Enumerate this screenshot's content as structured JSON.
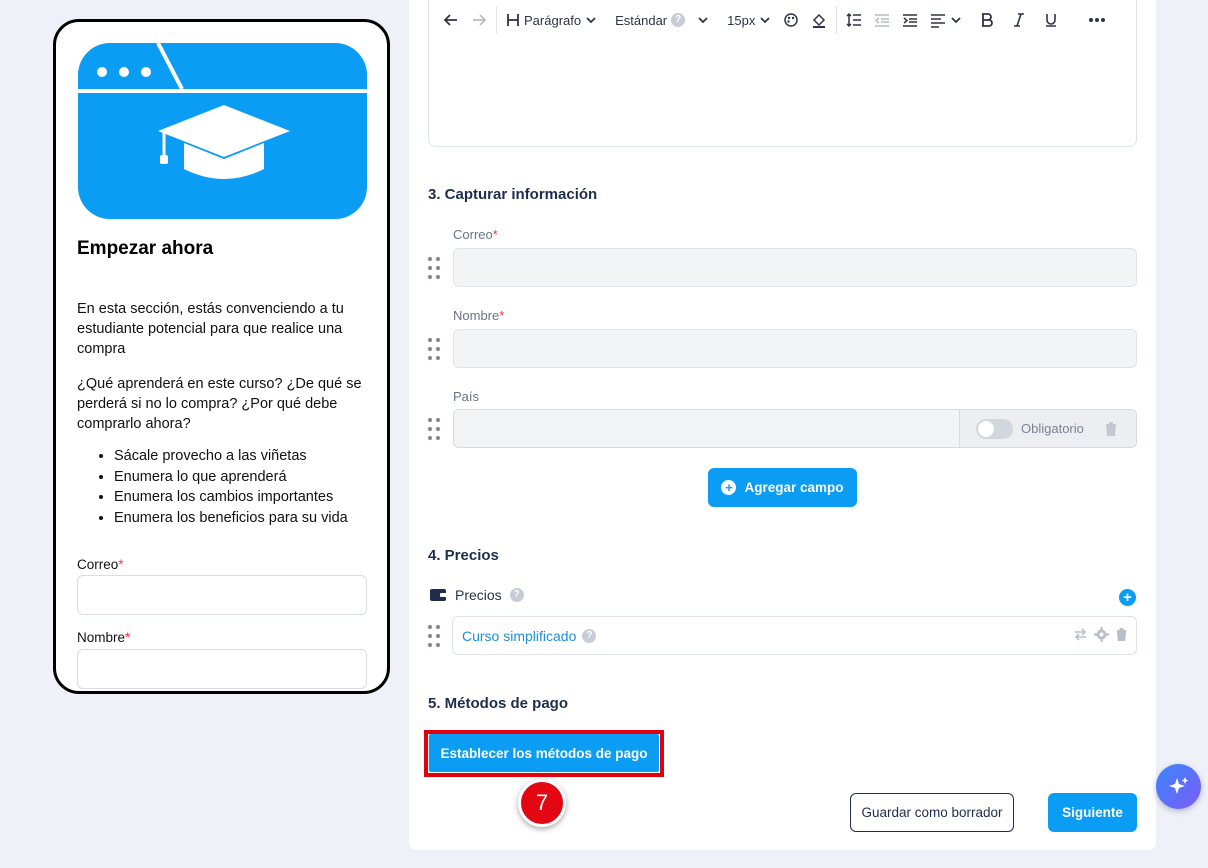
{
  "preview": {
    "title": "Empezar ahora",
    "paragraph1": "En esta sección, estás convenciendo a tu estudiante potencial para que realice una compra",
    "paragraph2": "¿Qué aprenderá en este curso? ¿De qué se perderá si no lo compra? ¿Por qué debe comprarlo ahora?",
    "bullets": [
      "Sácale provecho a las viñetas",
      "Enumera lo que aprenderá",
      "Enumera los cambios importantes",
      "Enumera los beneficios para su vida"
    ],
    "email_label": "Correo",
    "name_label": "Nombre",
    "required_mark": "*",
    "hero_color": "#0b9cf3"
  },
  "toolbar": {
    "heading_label": "Parágrafo",
    "style_label": "Estándar",
    "help_mark": "?",
    "size_label": "15px"
  },
  "capture": {
    "heading": "3. Capturar información",
    "fields": [
      {
        "label": "Correo",
        "required": true
      },
      {
        "label": "Nombre",
        "required": true
      },
      {
        "label": "País",
        "required": false
      }
    ],
    "required_toggle_label": "Obligatorio",
    "add_field_label": "Agregar campo"
  },
  "pricing": {
    "heading": "4. Precios",
    "label": "Precios",
    "help_mark": "?",
    "items": [
      {
        "name": "Curso simplificado"
      }
    ]
  },
  "payment": {
    "heading": "5. Métodos de pago",
    "set_methods_label": "Establecer los métodos de pago",
    "step_number": "7"
  },
  "footer": {
    "draft_label": "Guardar como borrador",
    "next_label": "Siguiente"
  },
  "colors": {
    "accent": "#0b9cf3",
    "highlight": "#e0000f",
    "heading": "#1f2d4d"
  }
}
